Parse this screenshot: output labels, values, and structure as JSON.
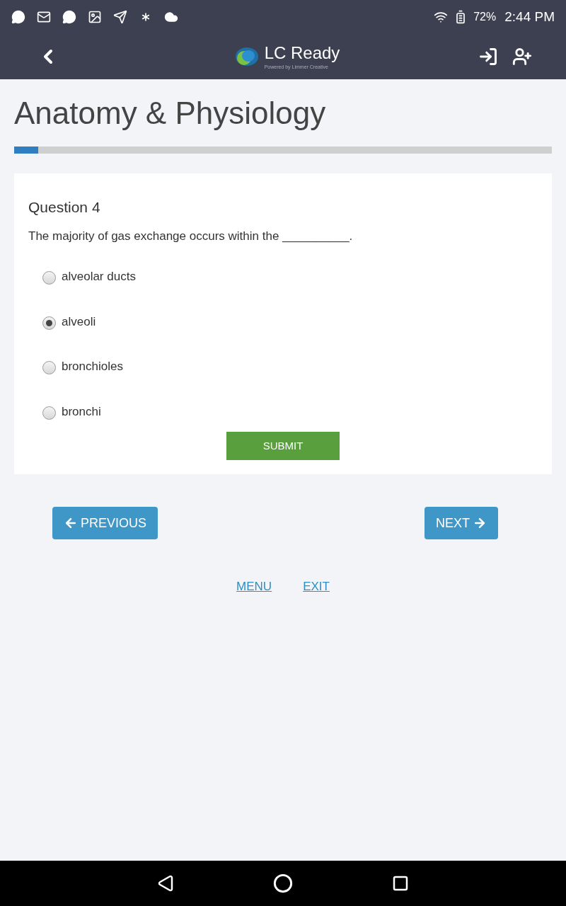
{
  "status_bar": {
    "battery": "72%",
    "time": "2:44 PM"
  },
  "header": {
    "logo_title": "LC Ready",
    "logo_subtitle": "Powered by Limmer Creative"
  },
  "page_title": "Anatomy & Physiology",
  "progress": {
    "level": 0.045
  },
  "question": {
    "heading": "Question 4",
    "text": "The majority of gas exchange occurs within the __________.",
    "options": [
      {
        "label": "alveolar ducts",
        "selected": false
      },
      {
        "label": "alveoli",
        "selected": true
      },
      {
        "label": "bronchioles",
        "selected": false
      },
      {
        "label": "bronchi",
        "selected": false
      }
    ],
    "submit": "SUBMIT"
  },
  "nav": {
    "previous": "PREVIOUS",
    "next": "NEXT"
  },
  "links": [
    "MENU",
    "EXIT"
  ]
}
